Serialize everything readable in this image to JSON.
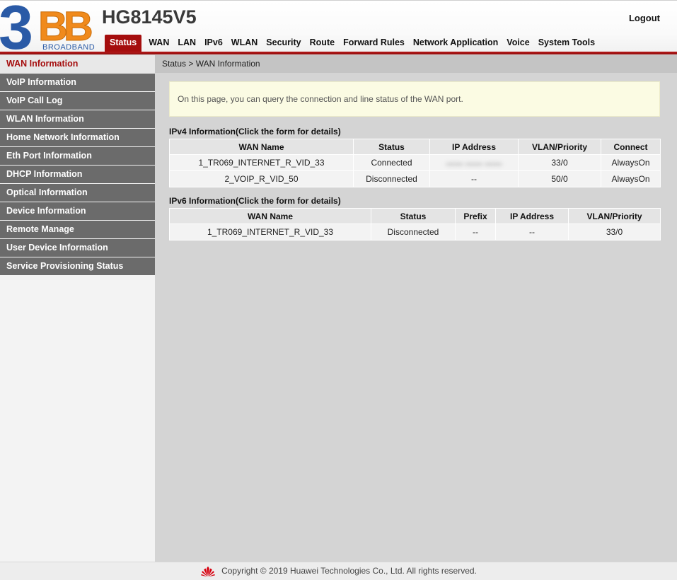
{
  "header": {
    "logo": {
      "big": "3",
      "bb": "BB",
      "sub": "BROADBAND"
    },
    "model": "HG8145V5",
    "logout_label": "Logout",
    "accent_color": "#a50e0e"
  },
  "topnav": {
    "items": [
      {
        "label": "Status",
        "active": true
      },
      {
        "label": "WAN"
      },
      {
        "label": "LAN"
      },
      {
        "label": "IPv6"
      },
      {
        "label": "WLAN"
      },
      {
        "label": "Security"
      },
      {
        "label": "Route"
      },
      {
        "label": "Forward Rules"
      },
      {
        "label": "Network Application"
      },
      {
        "label": "Voice"
      },
      {
        "label": "System Tools"
      }
    ]
  },
  "sidebar": {
    "items": [
      {
        "label": "WAN Information",
        "active": true
      },
      {
        "label": "VoIP Information"
      },
      {
        "label": "VoIP Call Log"
      },
      {
        "label": "WLAN Information"
      },
      {
        "label": "Home Network Information"
      },
      {
        "label": "Eth Port Information"
      },
      {
        "label": "DHCP Information"
      },
      {
        "label": "Optical Information"
      },
      {
        "label": "Device Information"
      },
      {
        "label": "Remote Manage"
      },
      {
        "label": "User Device Information"
      },
      {
        "label": "Service Provisioning Status"
      }
    ]
  },
  "main": {
    "breadcrumb": "Status > WAN Information",
    "notice": "On this page, you can query the connection and line status of the WAN port.",
    "ipv4": {
      "title": "IPv4 Information(Click the form for details)",
      "headers": [
        "WAN Name",
        "Status",
        "IP Address",
        "VLAN/Priority",
        "Connect"
      ],
      "rows": [
        [
          "1_TR069_INTERNET_R_VID_33",
          "Connected",
          "",
          "33/0",
          "AlwaysOn"
        ],
        [
          "2_VOIP_R_VID_50",
          "Disconnected",
          "--",
          "50/0",
          "AlwaysOn"
        ]
      ]
    },
    "ipv6": {
      "title": "IPv6 Information(Click the form for details)",
      "headers": [
        "WAN Name",
        "Status",
        "Prefix",
        "IP Address",
        "VLAN/Priority"
      ],
      "rows": [
        [
          "1_TR069_INTERNET_R_VID_33",
          "Disconnected",
          "--",
          "--",
          "33/0"
        ]
      ]
    }
  },
  "footer": {
    "copyright": "Copyright © 2019 Huawei Technologies Co., Ltd. All rights reserved.",
    "icon": "huawei-logo-icon"
  }
}
